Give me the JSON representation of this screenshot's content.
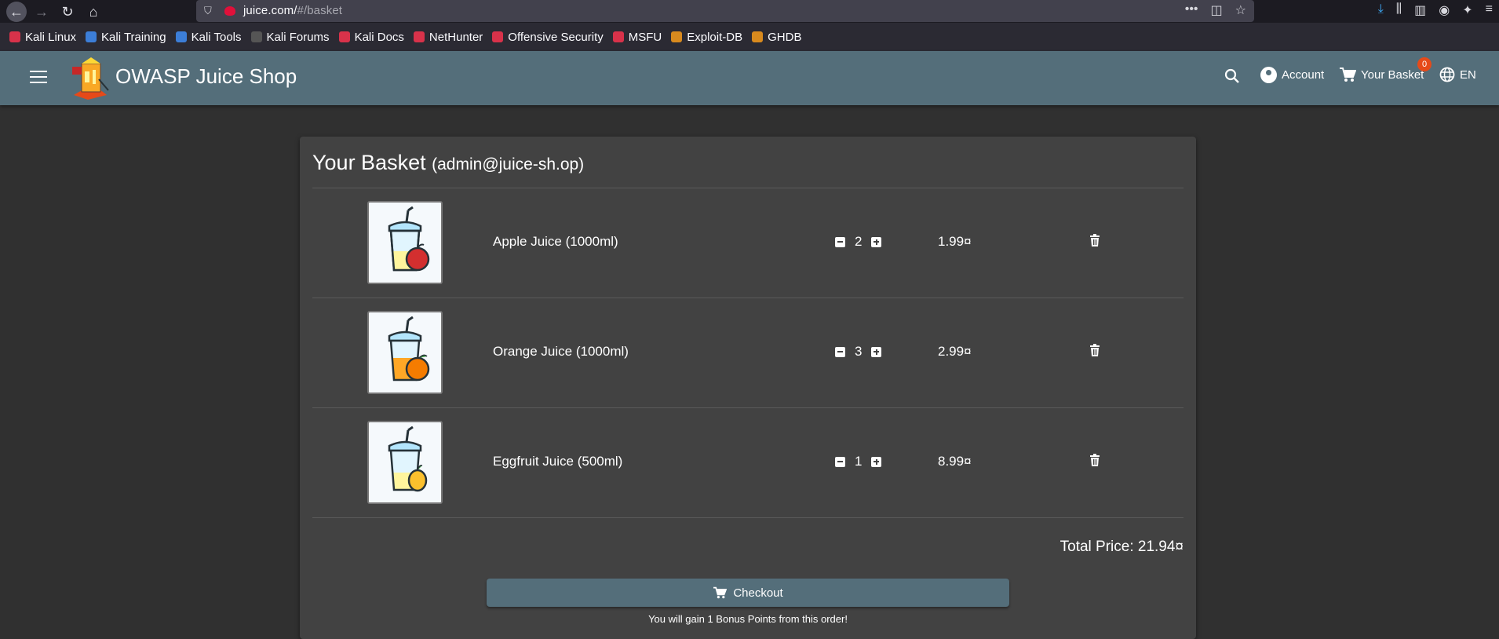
{
  "browser": {
    "url_host": "juice.com/",
    "url_path": "#/basket"
  },
  "bookmarks": [
    {
      "label": "Kali Linux",
      "icon": "kali-icon"
    },
    {
      "label": "Kali Training",
      "icon": "kali-training-icon"
    },
    {
      "label": "Kali Tools",
      "icon": "kali-tools-icon"
    },
    {
      "label": "Kali Forums",
      "icon": "kali-forums-icon"
    },
    {
      "label": "Kali Docs",
      "icon": "kali-docs-icon"
    },
    {
      "label": "NetHunter",
      "icon": "nethunter-icon"
    },
    {
      "label": "Offensive Security",
      "icon": "offsec-icon"
    },
    {
      "label": "MSFU",
      "icon": "msfu-icon"
    },
    {
      "label": "Exploit-DB",
      "icon": "exploitdb-icon"
    },
    {
      "label": "GHDB",
      "icon": "ghdb-icon"
    }
  ],
  "header": {
    "title": "OWASP Juice Shop",
    "account_label": "Account",
    "basket_label": "Your Basket",
    "basket_count": "0",
    "language": "EN"
  },
  "basket": {
    "title": "Your Basket",
    "user": "(admin@juice-sh.op)",
    "items": [
      {
        "name": "Apple Juice (1000ml)",
        "quantity": "2",
        "price": "1.99¤",
        "fruit_color": "#d32f2f"
      },
      {
        "name": "Orange Juice (1000ml)",
        "quantity": "3",
        "price": "2.99¤",
        "fruit_color": "#f57c00"
      },
      {
        "name": "Eggfruit Juice (500ml)",
        "quantity": "1",
        "price": "8.99¤",
        "fruit_color": "#fbc02d"
      }
    ],
    "total": "Total Price: 21.94¤",
    "checkout_label": "Checkout",
    "bonus_text": "You will gain 1 Bonus Points from this order!"
  },
  "colors": {
    "toolbar": "#546e7a",
    "background": "#303030",
    "card": "#424242",
    "badge": "#e64a19"
  }
}
